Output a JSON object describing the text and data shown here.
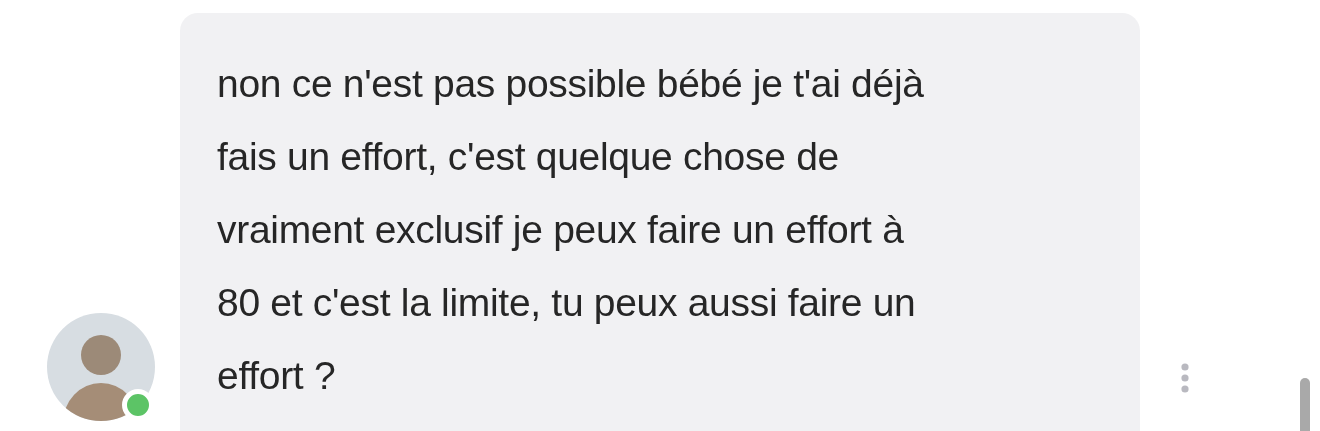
{
  "message": {
    "text": "non ce n'est pas possible bébé je t'ai déjà\nfais un effort, c'est quelque chose de\nvraiment exclusif je peux faire un effort à\n80 et c'est la limite, tu peux aussi faire un\neffort ?"
  },
  "sender": {
    "online": true
  }
}
